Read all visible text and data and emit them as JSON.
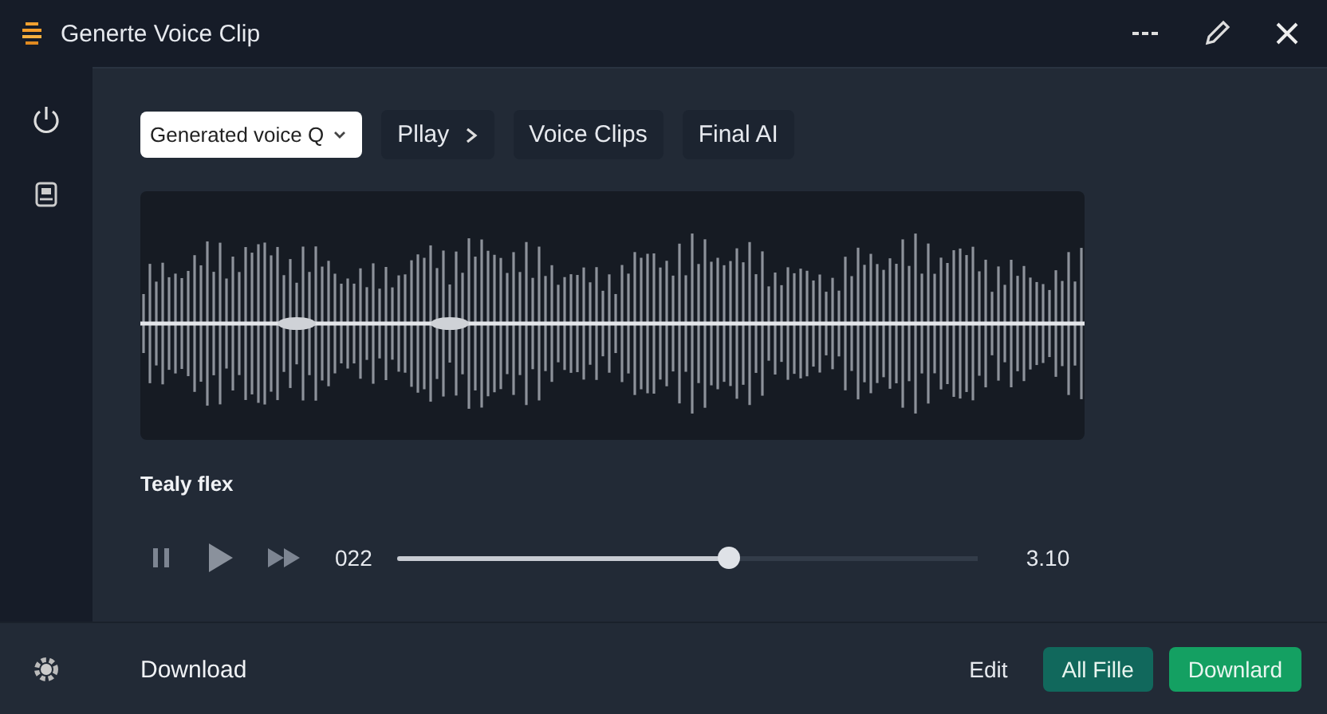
{
  "window": {
    "title": "Generte Voice Clip"
  },
  "toolbar": {
    "dropdown": {
      "value": "Generated voice Q"
    },
    "buttons": [
      {
        "label": "Pllay",
        "kind": "next"
      },
      {
        "label": "Voice Clips",
        "kind": "plain"
      },
      {
        "label": "Final AI",
        "kind": "plain"
      }
    ]
  },
  "clip": {
    "name": "Tealy flex"
  },
  "player": {
    "current": "022",
    "total": "3.10",
    "level": 0.57
  },
  "footer": {
    "link": "Download",
    "edit": "Edit",
    "buttons": [
      {
        "label": "All Fille",
        "kind": "secondary"
      },
      {
        "label": "Downlard",
        "kind": "primary"
      }
    ]
  }
}
